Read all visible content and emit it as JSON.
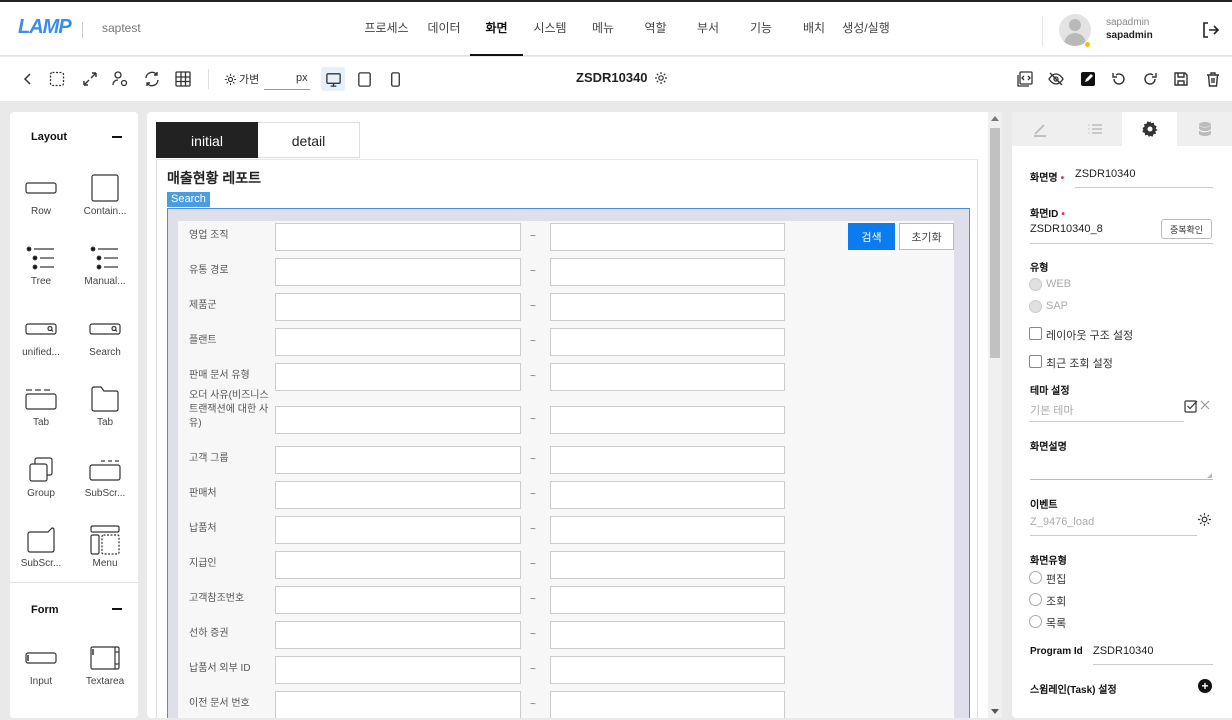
{
  "header": {
    "logo": "LAMP",
    "project": "saptest",
    "nav": [
      {
        "label": "프로세스",
        "active": false
      },
      {
        "label": "데이터",
        "active": false
      },
      {
        "label": "화면",
        "active": true
      },
      {
        "label": "시스템",
        "active": false
      },
      {
        "label": "메뉴",
        "active": false
      },
      {
        "label": "역할",
        "active": false
      },
      {
        "label": "부서",
        "active": false
      },
      {
        "label": "기능",
        "active": false
      },
      {
        "label": "배치",
        "active": false
      },
      {
        "label": "생성/실행",
        "active": false
      }
    ],
    "user": {
      "name": "sapadmin",
      "display_name": "sapadmin",
      "status_color": "#f2c200"
    }
  },
  "toolbar": {
    "variable_label": "가변",
    "px_value": "",
    "px_unit": "px",
    "page_id": "ZSDR10340",
    "left_icons": [
      "back-icon",
      "select-area-icon",
      "expand-icon",
      "user-settings-icon",
      "refresh-icon",
      "grid-table-icon"
    ],
    "devices": [
      "desktop-icon",
      "tablet-icon",
      "mobile-icon"
    ],
    "active_device": "desktop",
    "right_icons": [
      "code-view-icon",
      "hide-icon",
      "edit-icon",
      "undo-icon",
      "redo-icon",
      "save-icon",
      "delete-icon"
    ]
  },
  "components": {
    "layout": {
      "title": "Layout",
      "items": [
        "Row",
        "Contain...",
        "Tree",
        "Manual...",
        "unified...",
        "Search",
        "Tab",
        "Tab",
        "Group",
        "SubScr...",
        "SubScr...",
        "Menu"
      ]
    },
    "form": {
      "title": "Form",
      "items": [
        "Input",
        "Textarea"
      ]
    }
  },
  "canvas": {
    "tabs": [
      {
        "label": "initial",
        "active": true
      },
      {
        "label": "detail",
        "active": false
      }
    ],
    "report_title": "매출현황 레포트",
    "search_tag": "Search",
    "search_button": "검색",
    "reset_button": "초기화",
    "range_separator": "~",
    "fields": [
      {
        "label": "영업 조직",
        "from": "",
        "to": ""
      },
      {
        "label": "유통 경로",
        "from": "",
        "to": ""
      },
      {
        "label": "제품군",
        "from": "",
        "to": ""
      },
      {
        "label": "플랜트",
        "from": "",
        "to": ""
      },
      {
        "label": "판매 문서 유형",
        "from": "",
        "to": ""
      },
      {
        "label": "오더 사유(비즈니스 트랜잭션에 대한 사유)",
        "from": "",
        "to": ""
      },
      {
        "label": "고객 그룹",
        "from": "",
        "to": ""
      },
      {
        "label": "판매처",
        "from": "",
        "to": ""
      },
      {
        "label": "납품처",
        "from": "",
        "to": ""
      },
      {
        "label": "지급인",
        "from": "",
        "to": ""
      },
      {
        "label": "고객참조번호",
        "from": "",
        "to": ""
      },
      {
        "label": "선하 증권",
        "from": "",
        "to": ""
      },
      {
        "label": "납품서 외부 ID",
        "from": "",
        "to": ""
      },
      {
        "label": "이전 문서 번호",
        "from": "",
        "to": ""
      }
    ]
  },
  "properties": {
    "tabs": [
      "pencil-icon",
      "list-icon",
      "gear-icon",
      "database-icon"
    ],
    "active_tab": 2,
    "screen_name_label": "화면명",
    "screen_name": "ZSDR10340",
    "screen_id_label": "화면ID",
    "screen_id": "ZSDR10340_8",
    "dup_check": "중복확인",
    "type_label": "유형",
    "type_options": [
      "WEB",
      "SAP"
    ],
    "layout_structure": "레이아웃 구조 설정",
    "recent_search": "최근 조회 설정",
    "theme_label": "테마 설정",
    "theme_placeholder": "기본 테마",
    "description_label": "화면설명",
    "description": "",
    "event_label": "이벤트",
    "event_placeholder": "Z_9476_load",
    "screen_type_label": "화면유형",
    "screen_type_options": [
      "편집",
      "조회",
      "목록"
    ],
    "program_id_label": "Program Id",
    "program_id": "ZSDR10340",
    "swimlane_label": "스윔레인(Task) 설정"
  }
}
